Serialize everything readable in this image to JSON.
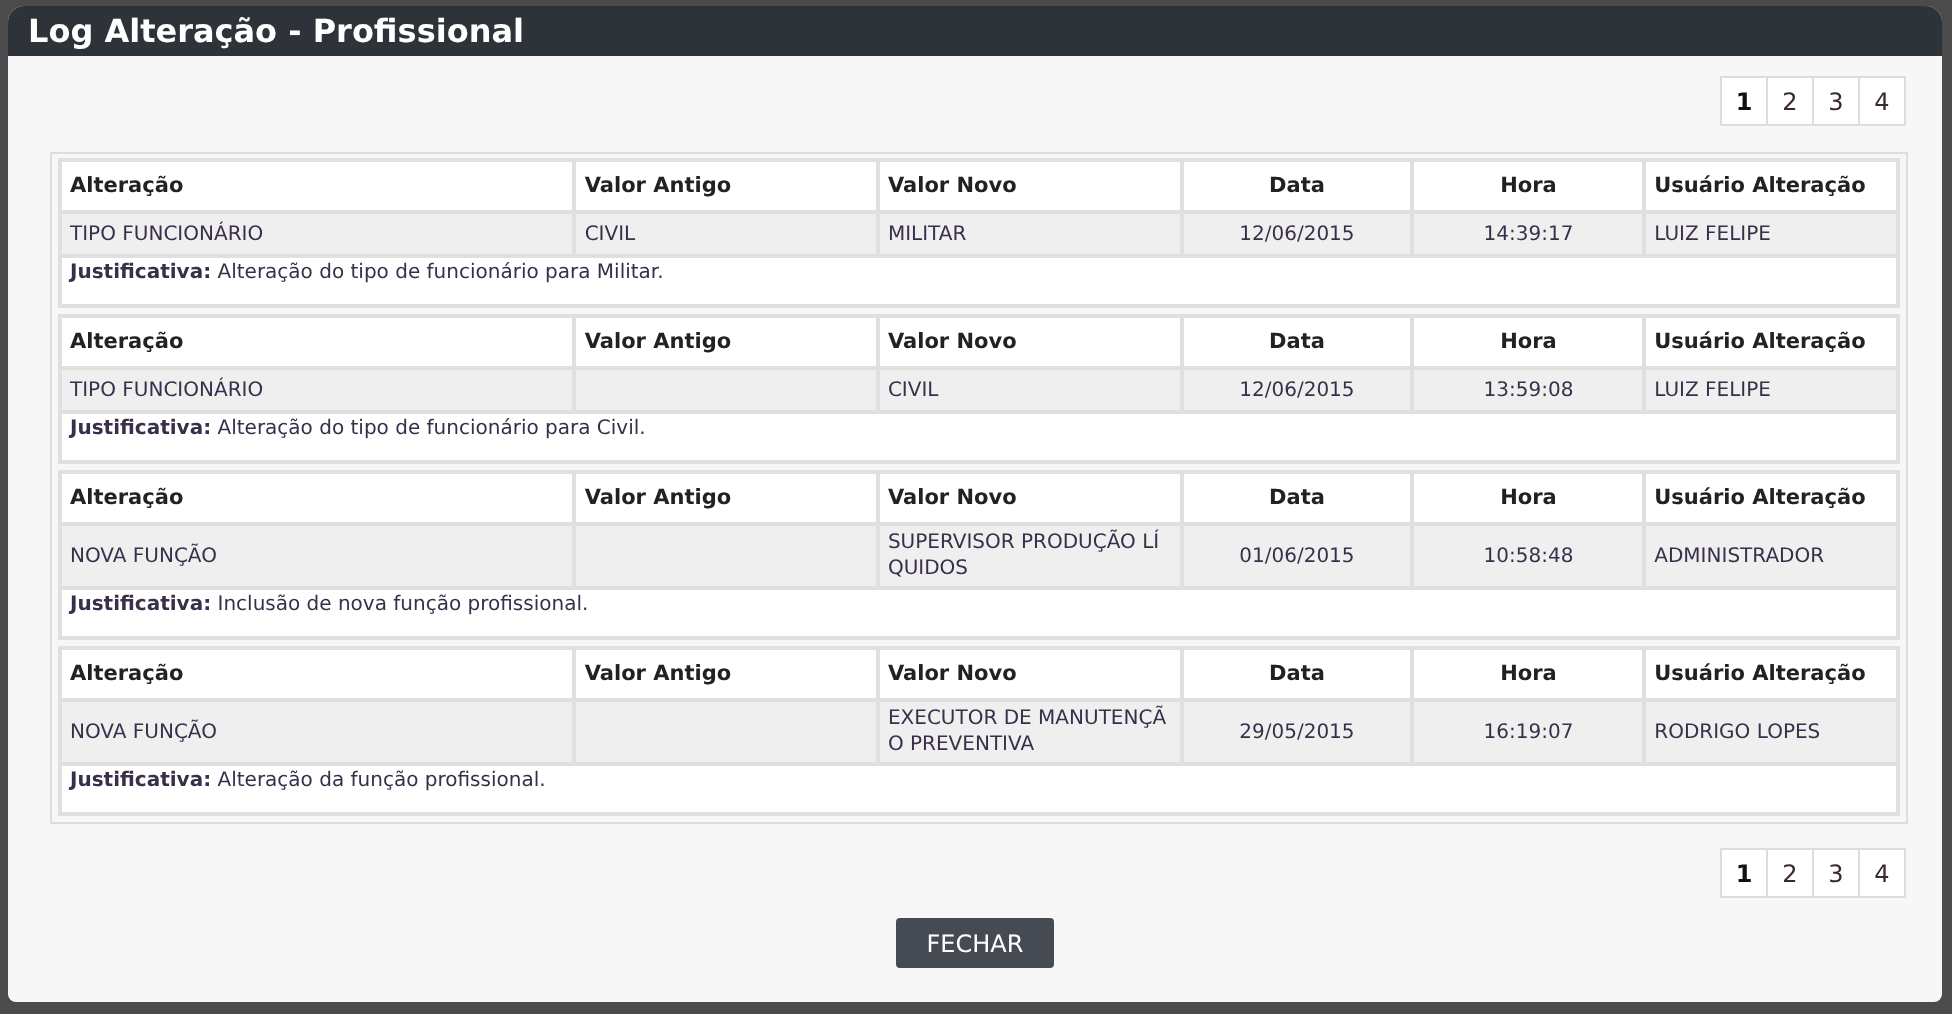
{
  "window": {
    "title": "Log Alteração - Profissional"
  },
  "pagination_top": [
    {
      "label": "1",
      "selected": true
    },
    {
      "label": "2",
      "selected": false
    },
    {
      "label": "3",
      "selected": false
    },
    {
      "label": "4",
      "selected": false
    }
  ],
  "entries": [
    {
      "columns": [
        "Alteração",
        "Valor Antigo",
        "Valor Novo",
        "Data",
        "Hora",
        "Usuário Alteração"
      ],
      "cells": [
        "TIPO FUNCIONÁRIO",
        "CIVIL",
        "MILITAR",
        "12/06/2015",
        "14:39:17",
        "LUIZ FELIPE"
      ],
      "justification_label": "Justificativa:",
      "justification": "Alteração do tipo de funcionário para Militar."
    },
    {
      "columns": [
        "Alteração",
        "Valor Antigo",
        "Valor Novo",
        "Data",
        "Hora",
        "Usuário Alteração"
      ],
      "cells": [
        "TIPO FUNCIONÁRIO",
        "",
        "CIVIL",
        "12/06/2015",
        "13:59:08",
        "LUIZ FELIPE"
      ],
      "justification_label": "Justificativa:",
      "justification": "Alteração do tipo de funcionário para Civil."
    },
    {
      "columns": [
        "Alteração",
        "Valor Antigo",
        "Valor Novo",
        "Data",
        "Hora",
        "Usuário Alteração"
      ],
      "cells": [
        "NOVA FUNÇÃO",
        "",
        "SUPERVISOR PRODUÇÃO LÍQUIDOS",
        "01/06/2015",
        "10:58:48",
        "ADMINISTRADOR"
      ],
      "justification_label": "Justificativa:",
      "justification": "Inclusão de nova função profissional."
    },
    {
      "columns": [
        "Alteração",
        "Valor Antigo",
        "Valor Novo",
        "Data",
        "Hora",
        "Usuário Alteração"
      ],
      "cells": [
        "NOVA FUNÇÃO",
        "",
        "EXECUTOR DE MANUTENÇÃO PREVENTIVA",
        "29/05/2015",
        "16:19:07",
        "RODRIGO LOPES"
      ],
      "justification_label": "Justificativa:",
      "justification": "Alteração da função profissional."
    }
  ],
  "pagination_bottom": [
    {
      "label": "1",
      "selected": true
    },
    {
      "label": "2",
      "selected": false
    },
    {
      "label": "3",
      "selected": false
    },
    {
      "label": "4",
      "selected": false
    }
  ],
  "close_button": "FECHAR"
}
